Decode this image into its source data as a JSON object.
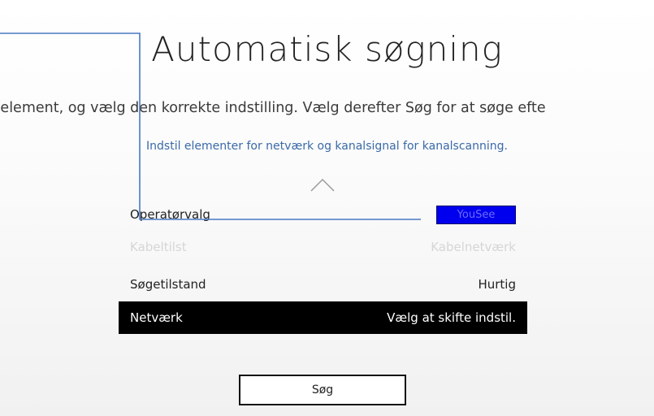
{
  "colors": {
    "background": "#f8f8f8",
    "text": "#222222",
    "subtitle_blue": "#3a6aa8",
    "selected_row_bg": "#000000",
    "badge_blue": "#0000ee",
    "disabled_text": "#d6d6d6",
    "annotation_line": "#4a78c2"
  },
  "screen": {
    "title": "Automatisk søgning",
    "instruction": "t element, og vælg den korrekte indstilling. Vælg derefter Søg for at søge efte",
    "subtitle": "Indstil elementer for netværk og kanalsignal for kanalscanning.",
    "up_icon": "chevron-up-icon"
  },
  "menu": {
    "items": [
      {
        "label": "Operatørvalg",
        "value": "YouSee",
        "state": "normal"
      },
      {
        "label": "Kabeltilst",
        "value": "Kabelnetværk",
        "state": "disabled"
      },
      {
        "label": "Søgetilstand",
        "value": "Hurtig",
        "state": "normal"
      },
      {
        "label": "Netværk",
        "value": "Vælg at skifte indstil.",
        "state": "selected"
      }
    ]
  },
  "actions": {
    "search_label": "Søg"
  }
}
